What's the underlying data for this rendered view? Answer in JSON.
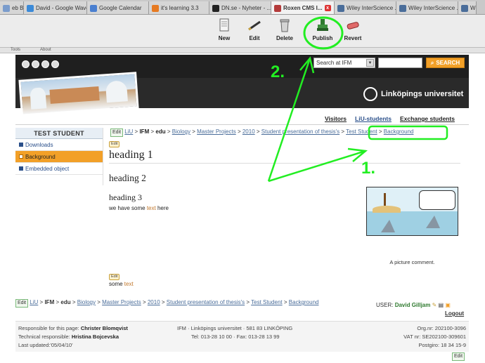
{
  "browser": {
    "tabs": [
      {
        "label": "eb Bas...",
        "color": "#7a9ccc"
      },
      {
        "label": "David - Google Wave",
        "color": "#3b8ad8"
      },
      {
        "label": "Google Calendar",
        "color": "#4a7fd0"
      },
      {
        "label": "it's learning 3.3",
        "color": "#e67a22"
      },
      {
        "label": "DN.se - Nyheter - ...",
        "color": "#222222"
      },
      {
        "label": "Roxen CMS I...",
        "color": "#b43b3b",
        "active": true
      },
      {
        "label": "Wiley InterScience ...",
        "color": "#4a6d9a"
      },
      {
        "label": "Wiley InterScience ...",
        "color": "#4a6d9a"
      },
      {
        "label": "W",
        "color": "#4a6d9a"
      }
    ],
    "close_symbol": "x"
  },
  "cms_toolbar": {
    "buttons": [
      {
        "label": "New",
        "icon": "new-page-icon"
      },
      {
        "label": "Edit",
        "icon": "pen-icon"
      },
      {
        "label": "Delete",
        "icon": "trash-icon"
      },
      {
        "label": "Publish",
        "icon": "stamp-icon"
      },
      {
        "label": "Revert",
        "icon": "eraser-icon"
      }
    ],
    "subtabs": [
      "Tools",
      "About"
    ]
  },
  "site": {
    "search_scope": "Search at IFM",
    "search_button": "SEARCH",
    "university": "Linköpings universitet",
    "nav_links": [
      "Visitors",
      "LiU-students",
      "Exchange students"
    ]
  },
  "sidebar": {
    "title": "TEST STUDENT",
    "items": [
      {
        "label": "Downloads"
      },
      {
        "label": "Background",
        "active": true
      },
      {
        "label": "Embedded object"
      }
    ]
  },
  "breadcrumb": {
    "edit": "Edit",
    "parts": [
      "LiU",
      "IFM",
      "edu",
      "Biology",
      "Master Projects",
      "2010",
      "Student presentation of thesis's",
      "Test Student",
      "Background"
    ],
    "separator": ">"
  },
  "content": {
    "edit_mini": "Edit",
    "heading1": "heading 1",
    "heading2": "heading 2",
    "heading3": "heading 3",
    "body_before": "we have some ",
    "body_accent": "text",
    "body_after": " here",
    "picture_caption": "A picture comment.",
    "some_text_before": "some ",
    "some_text_accent": "text"
  },
  "footer_bar": {
    "user_label": "USER:",
    "user_name": "David Gilljam",
    "logout": "Logout"
  },
  "footer": {
    "responsible_label": "Responsible for this page:",
    "responsible_name": "Christer Blomqvist",
    "technical_label": "Technical responsible:",
    "technical_name": "Hristina Bojcevska",
    "updated": "Last updated:'05/04/10'",
    "address": "IFM · Linköpings universitet · 581 83 LINKÖPING",
    "phone": "Tel: 013-28 10 00 · Fax: 013-28 13 99",
    "org": "Org.nr: 202100-3096",
    "vat": "VAT nr: SE202100-309601",
    "postgiro": "Postgiro: 18 34 15-9",
    "edit": "Edit"
  },
  "annotations": {
    "label_1": "1.",
    "label_2": "2.",
    "color": "#22ee22"
  }
}
